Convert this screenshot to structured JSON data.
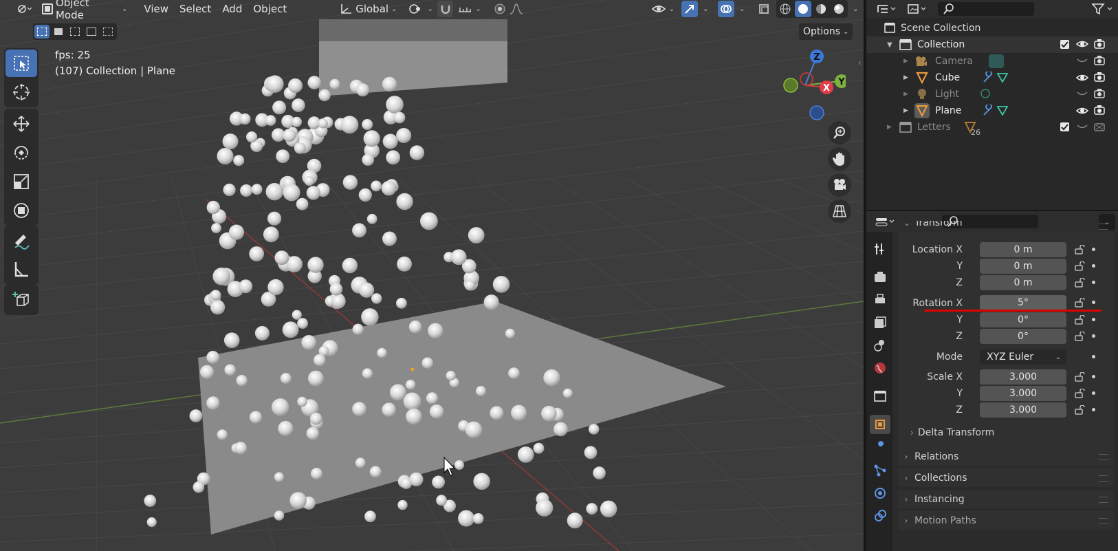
{
  "header": {
    "mode": "Object Mode",
    "menus": [
      "View",
      "Select",
      "Add",
      "Object"
    ],
    "orientation": "Global",
    "options": "Options"
  },
  "overlay": {
    "fps": "fps: 25",
    "context": "(107) Collection | Plane"
  },
  "gizmo": {
    "z": "Z",
    "y": "Y",
    "x": "X"
  },
  "outliner": {
    "scene_collection": "Scene Collection",
    "collection": "Collection",
    "items": [
      {
        "label": "Camera",
        "icon": "camera-icon",
        "color": "#c8a160",
        "dim": true
      },
      {
        "label": "Cube",
        "icon": "mesh-icon",
        "color": "#e89a3c",
        "dim": false
      },
      {
        "label": "Light",
        "icon": "light-icon",
        "color": "#c8a160",
        "dim": true
      },
      {
        "label": "Plane",
        "icon": "mesh-icon",
        "color": "#e89a3c",
        "dim": false
      }
    ],
    "letters": "Letters",
    "letters_count": "26"
  },
  "properties": {
    "section": "Transform",
    "location": {
      "label": "Location X",
      "x": "0 m",
      "y": "0 m",
      "z": "0 m"
    },
    "rotation": {
      "label": "Rotation X",
      "x": "5°",
      "y": "0°",
      "z": "0°"
    },
    "mode": {
      "label": "Mode",
      "value": "XYZ Euler"
    },
    "scale": {
      "label": "Scale X",
      "x": "3.000",
      "y": "3.000",
      "z": "3.000"
    },
    "axis_y": "Y",
    "axis_z": "Z",
    "delta": "Delta Transform",
    "panels": [
      "Relations",
      "Collections",
      "Instancing",
      "Motion Paths"
    ]
  },
  "colors": {
    "accent": "#4772b3",
    "highlight": "#e00000",
    "object_orange": "#e89a3c"
  }
}
